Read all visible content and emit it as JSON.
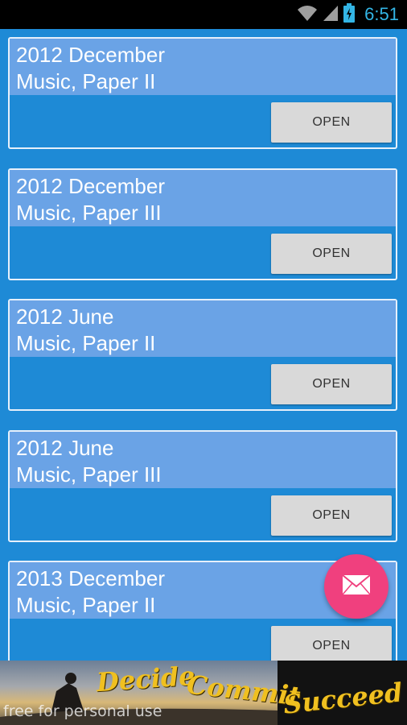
{
  "status_bar": {
    "time": "6:51",
    "icons": [
      "wifi-icon",
      "signal-icon",
      "battery-charging-icon"
    ],
    "time_color": "#33b5e5"
  },
  "cards": [
    {
      "line1": "2012 December",
      "line2": "Music, Paper II",
      "button": "OPEN"
    },
    {
      "line1": "2012 December",
      "line2": "Music, Paper III",
      "button": "OPEN"
    },
    {
      "line1": "2012 June",
      "line2": "Music, Paper II",
      "button": "OPEN"
    },
    {
      "line1": "2012 June",
      "line2": "Music, Paper III",
      "button": "OPEN"
    },
    {
      "line1": "2013 December",
      "line2": "Music, Paper II",
      "button": "OPEN"
    }
  ],
  "fab": {
    "icon": "mail-icon",
    "color": "#f0407e"
  },
  "ad": {
    "word1": "Decide",
    "word2": "Commit",
    "word3": "Succeed",
    "watermark": "free for personal use"
  },
  "colors": {
    "background": "#1e8ad6",
    "card_header": "#6aa3e6",
    "button": "#d9d9d9"
  }
}
